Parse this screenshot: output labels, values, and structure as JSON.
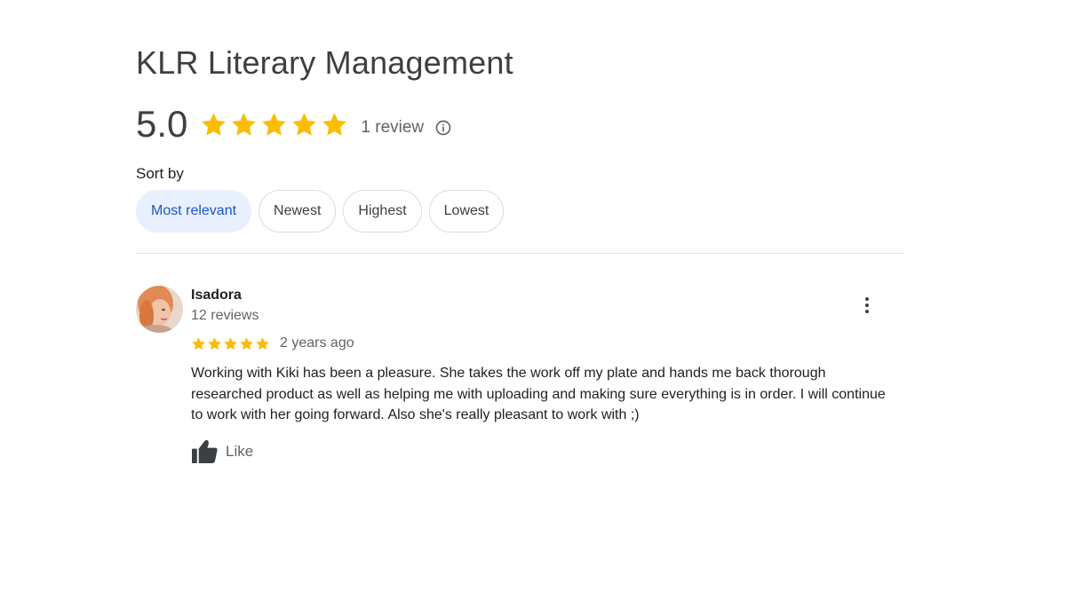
{
  "business": {
    "name": "KLR Literary Management",
    "rating": "5.0",
    "star_count": 5,
    "review_count_text": "1 review"
  },
  "sort": {
    "label": "Sort by",
    "options": [
      "Most relevant",
      "Newest",
      "Highest",
      "Lowest"
    ],
    "selected": "Most relevant"
  },
  "review": {
    "author": "Isadora",
    "author_meta": "12 reviews",
    "stars": 5,
    "date": "2 years ago",
    "text": "Working with Kiki has been a pleasure. She takes the work off my plate and hands me back thorough researched product as well as helping me with uploading and making sure everything is in order. I will continue to work with her going forward. Also she's really pleasant to work with ;)",
    "like_label": "Like"
  },
  "icons": {
    "star": "star-icon",
    "info": "info-icon",
    "more": "more-vert-icon",
    "like": "thumbs-up-icon"
  },
  "colors": {
    "star": "#fbbc04",
    "chip_active_bg": "#e8f0fe",
    "chip_active_text": "#1a56c4",
    "secondary_text": "#5f6368"
  }
}
